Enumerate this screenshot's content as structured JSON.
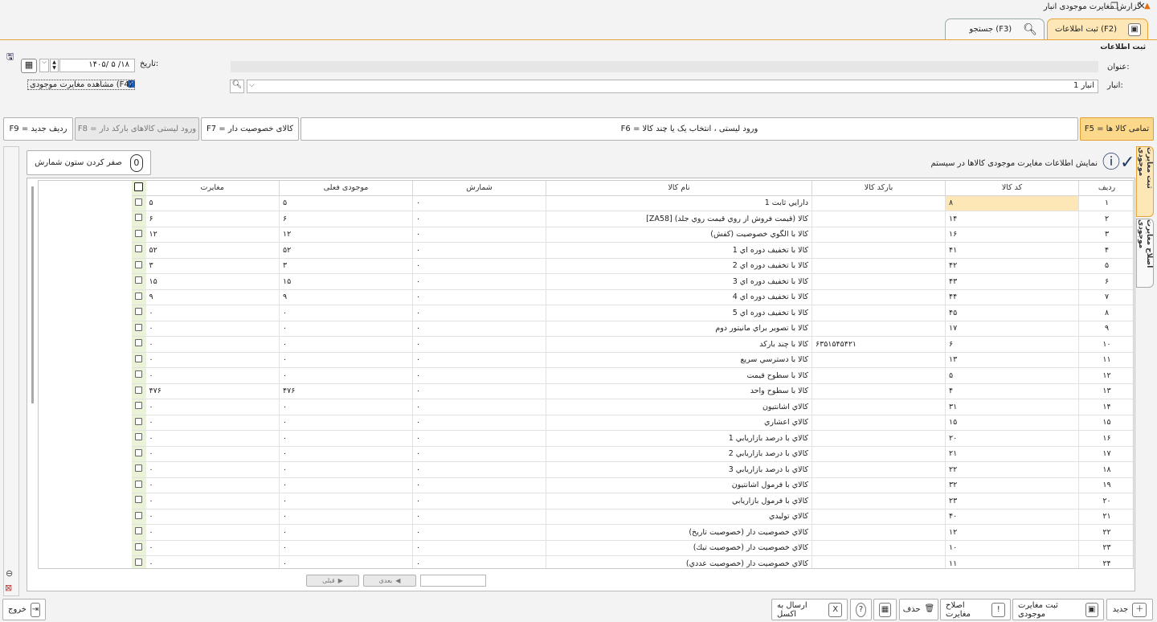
{
  "window": {
    "title": "گزارش مغایرت موجودی انبار",
    "restore_glyph": "❐",
    "close_glyph": "✕"
  },
  "tabs": {
    "save_label": "ثبت اطلاعات (F2)",
    "search_label": "جستجو (F3)"
  },
  "section_label": "ثبت اطلاعات",
  "form": {
    "title_label": "عنوان:",
    "title_value": "",
    "warehouse_label": "انبار:",
    "warehouse_value": "انبار 1",
    "date_label": "تاریخ:",
    "date_value": "۱۴۰۵/ ۵ /۱۸",
    "show_discrepancy_label": "مشاهده مغایرت موجودی (F4)"
  },
  "actions": {
    "all_items": "F5 = تمامی کالا ها",
    "list_input": "F6 = ورود لیستی ، انتخاب یک یا چند کالا",
    "property_items": "F7 = کالای خصوصیت دار",
    "barcode_items": "F8 = ورود لیستی کالاهای بارکد دار",
    "new_row": "F9 = ردیف جدید"
  },
  "info_text": "نمایش اطلاعات مغایرت موجودی کالاها در سیستم",
  "zero_count_label": "صفر کردن ستون شمارش",
  "side_tabs": [
    "ثبت مغایرت موجودی",
    "اصلاح مغایرت موجودی"
  ],
  "table": {
    "headers": {
      "row": "ردیف",
      "code": "کد کالا",
      "barcode": "بارکد کالا",
      "name": "نام کالا",
      "count": "شمارش",
      "current": "موجودی فعلی",
      "diff": "مغایرت"
    },
    "rows": [
      {
        "row": "۱",
        "code": "۸",
        "barcode": "",
        "name": "دارايي ثابت 1",
        "count": "۰",
        "current": "۵",
        "diff": "۵"
      },
      {
        "row": "۲",
        "code": "۱۴",
        "barcode": "",
        "name": "كالا (قيمت فروش از روي قيمت روي جلد) [ZA58]",
        "count": "۰",
        "current": "۶",
        "diff": "۶"
      },
      {
        "row": "۳",
        "code": "۱۶",
        "barcode": "",
        "name": "كالا با الگوي خصوصيت (كفش)",
        "count": "۰",
        "current": "۱۲",
        "diff": "۱۲"
      },
      {
        "row": "۴",
        "code": "۴۱",
        "barcode": "",
        "name": "كالا با تخفيف دوره اي 1",
        "count": "۰",
        "current": "۵۲",
        "diff": "۵۲"
      },
      {
        "row": "۵",
        "code": "۴۲",
        "barcode": "",
        "name": "كالا با تخفيف دوره اي 2",
        "count": "۰",
        "current": "۳",
        "diff": "۳"
      },
      {
        "row": "۶",
        "code": "۴۳",
        "barcode": "",
        "name": "كالا با تخفيف دوره اي 3",
        "count": "۰",
        "current": "۱۵",
        "diff": "۱۵"
      },
      {
        "row": "۷",
        "code": "۴۴",
        "barcode": "",
        "name": "كالا با تخفيف دوره اي 4",
        "count": "۰",
        "current": "۹",
        "diff": "۹"
      },
      {
        "row": "۸",
        "code": "۴۵",
        "barcode": "",
        "name": "كالا با تخفيف دوره اي 5",
        "count": "۰",
        "current": "۰",
        "diff": "۰"
      },
      {
        "row": "۹",
        "code": "۱۷",
        "barcode": "",
        "name": "كالا با تصوير براي مانيتور دوم",
        "count": "۰",
        "current": "۰",
        "diff": "۰"
      },
      {
        "row": "۱۰",
        "code": "۶",
        "barcode": "۶۳۵۱۵۴۵۴۲۱",
        "name": "كالا با چند باركد",
        "count": "۰",
        "current": "۰",
        "diff": "۰"
      },
      {
        "row": "۱۱",
        "code": "۱۳",
        "barcode": "",
        "name": "كالا با دسترسي سريع",
        "count": "۰",
        "current": "۰",
        "diff": "۰"
      },
      {
        "row": "۱۲",
        "code": "۵",
        "barcode": "",
        "name": "كالا با سطوح قيمت",
        "count": "۰",
        "current": "۰",
        "diff": "۰"
      },
      {
        "row": "۱۳",
        "code": "۴",
        "barcode": "",
        "name": "كالا با سطوح واحد",
        "count": "۰",
        "current": "۴۷۶",
        "diff": "۴۷۶"
      },
      {
        "row": "۱۴",
        "code": "۳۱",
        "barcode": "",
        "name": "كالاي اشانتيون",
        "count": "۰",
        "current": "۰",
        "diff": "۰"
      },
      {
        "row": "۱۵",
        "code": "۱۵",
        "barcode": "",
        "name": "كالاي اعشاري",
        "count": "۰",
        "current": "۰",
        "diff": "۰"
      },
      {
        "row": "۱۶",
        "code": "۲۰",
        "barcode": "",
        "name": "كالاي با درصد بازاريابي 1",
        "count": "۰",
        "current": "۰",
        "diff": "۰"
      },
      {
        "row": "۱۷",
        "code": "۲۱",
        "barcode": "",
        "name": "كالاي با درصد بازاريابي 2",
        "count": "۰",
        "current": "۰",
        "diff": "۰"
      },
      {
        "row": "۱۸",
        "code": "۲۲",
        "barcode": "",
        "name": "كالاي با درصد بازاريابي 3",
        "count": "۰",
        "current": "۰",
        "diff": "۰"
      },
      {
        "row": "۱۹",
        "code": "۳۲",
        "barcode": "",
        "name": "كالاي با فرمول اشانتيون",
        "count": "۰",
        "current": "۰",
        "diff": "۰"
      },
      {
        "row": "۲۰",
        "code": "۲۳",
        "barcode": "",
        "name": "كالاي با فرمول بازاريابي",
        "count": "۰",
        "current": "۰",
        "diff": "۰"
      },
      {
        "row": "۲۱",
        "code": "۴۰",
        "barcode": "",
        "name": "كالاي توليدي",
        "count": "۰",
        "current": "۰",
        "diff": "۰"
      },
      {
        "row": "۲۲",
        "code": "۱۲",
        "barcode": "",
        "name": "كالاي خصوصيت دار (خصوصيت تاريخ)",
        "count": "۰",
        "current": "۰",
        "diff": "۰"
      },
      {
        "row": "۲۳",
        "code": "۱۰",
        "barcode": "",
        "name": "كالاي خصوصيت دار (خصوصيت تيك)",
        "count": "۰",
        "current": "۰",
        "diff": "۰"
      },
      {
        "row": "۲۴",
        "code": "۱۱",
        "barcode": "",
        "name": "كالاي خصوصيت دار (خصوصيت عددي)",
        "count": "۰",
        "current": "۰",
        "diff": "۰"
      }
    ]
  },
  "pager": {
    "next": "بعدی",
    "prev": "قبلی",
    "page_value": ""
  },
  "bottom": {
    "new": "جدید",
    "register": "ثبت مغایرت موجودی",
    "correct": "اصلاح مغایرت",
    "delete": "حذف",
    "excel": "ارسال به اکسل",
    "exit": "خروج"
  },
  "colors": {
    "accent": "#fde7b7",
    "highlight": "#fbd88a",
    "check_col": "#eaf3d8"
  }
}
